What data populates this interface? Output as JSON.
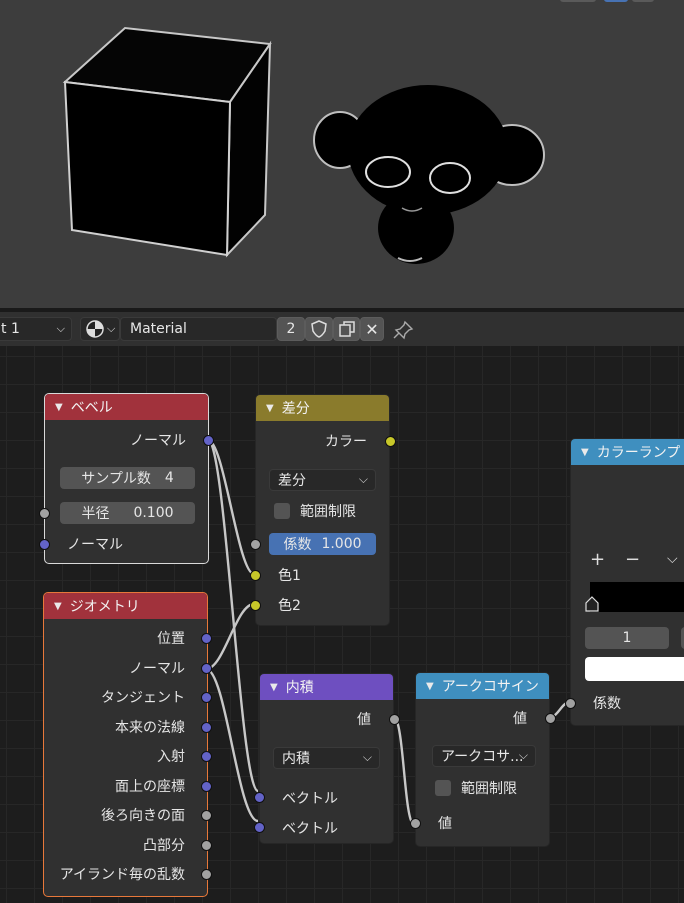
{
  "header": {
    "slot_label": "t 1",
    "material_name": "Material",
    "user_count": "2"
  },
  "nodes": {
    "bevel": {
      "title": "ベベル",
      "output_normal": "ノーマル",
      "samples_label": "サンプル数",
      "samples_value": "4",
      "radius_label": "半径",
      "radius_value": "0.100",
      "input_normal": "ノーマル",
      "header_color": "#a1323c"
    },
    "difference": {
      "title": "差分",
      "output_color": "カラー",
      "blend_mode": "差分",
      "clamp_label": "範囲制限",
      "factor_label": "係数",
      "factor_value": "1.000",
      "color1": "色1",
      "color2": "色2",
      "header_color": "#8a7b2c"
    },
    "geometry": {
      "title": "ジオメトリ",
      "outputs": [
        "位置",
        "ノーマル",
        "タンジェント",
        "本来の法線",
        "入射",
        "面上の座標",
        "後ろ向きの面",
        "凸部分",
        "アイランド毎の乱数"
      ],
      "header_color": "#a1323c"
    },
    "dot_product": {
      "title": "内積",
      "output_value": "値",
      "operation": "内積",
      "input_vector_1": "ベクトル",
      "input_vector_2": "ベクトル",
      "header_color": "#6e4fc0"
    },
    "arccosine": {
      "title": "アークコサイン",
      "output_value": "値",
      "operation": "アークコサ...",
      "clamp_label": "範囲制限",
      "input_value": "値",
      "header_color": "#3f8fbf"
    },
    "color_ramp": {
      "title": "カラーランプ",
      "add_symbol": "+",
      "remove_symbol": "−",
      "stop_index": "1",
      "input_factor": "係数",
      "header_color": "#3f8fbf"
    }
  }
}
